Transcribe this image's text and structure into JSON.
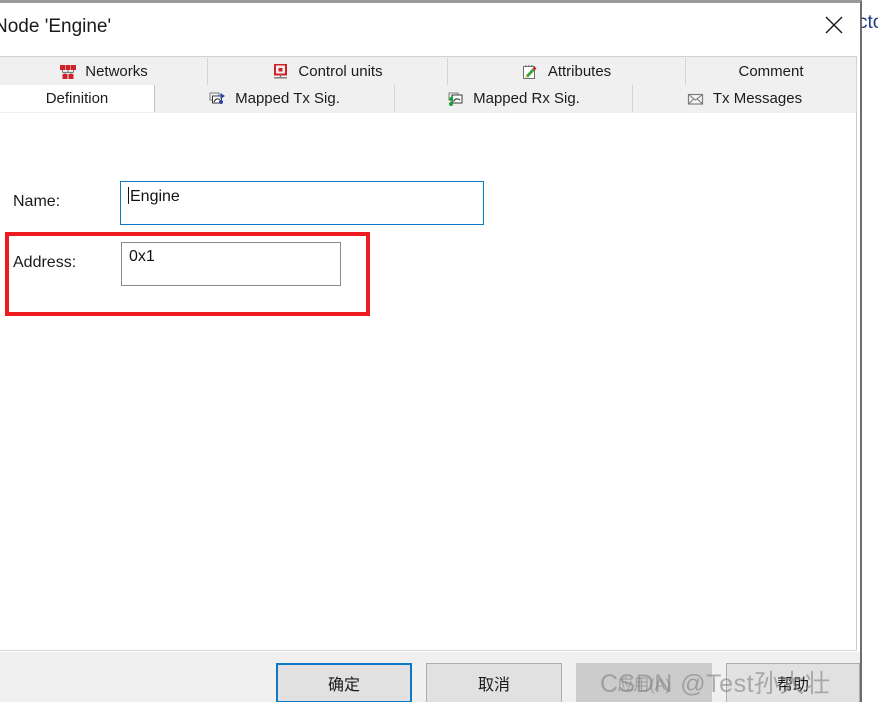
{
  "window": {
    "title": "Node 'Engine'",
    "close_label": "×",
    "background_window_text": "cto"
  },
  "tabs": {
    "row1": [
      {
        "label": "Networks",
        "icon": "network-icon",
        "active": false
      },
      {
        "label": "Control units",
        "icon": "control-unit-icon",
        "active": false
      },
      {
        "label": "Attributes",
        "icon": "attributes-icon",
        "active": false
      },
      {
        "label": "Comment",
        "icon": "",
        "active": false
      }
    ],
    "row2": [
      {
        "label": "Definition",
        "icon": "",
        "active": true
      },
      {
        "label": "Mapped Tx Sig.",
        "icon": "mapped-tx-icon",
        "active": false
      },
      {
        "label": "Mapped Rx Sig.",
        "icon": "mapped-rx-icon",
        "active": false
      },
      {
        "label": "Tx Messages",
        "icon": "envelope-icon",
        "active": false
      }
    ]
  },
  "form": {
    "name": {
      "label": "Name:",
      "value": "Engine",
      "placeholder": "",
      "focused": true
    },
    "address": {
      "label": "Address:",
      "value": "0x1",
      "placeholder": "",
      "focused": false
    }
  },
  "annotation": {
    "color": "#ee1b21",
    "target": "address-field-group"
  },
  "buttons": {
    "ok": "确定",
    "cancel": "取消",
    "apply": "应用(A)",
    "help": "帮助"
  },
  "watermark": {
    "text": "CSDN @Test孙大壮"
  },
  "colors": {
    "accent": "#0a7ac6",
    "annotation": "#ee1b21",
    "tabstrip_bg": "#f0f0f0",
    "buttonbar_bg": "#f0f0f0",
    "content_bg": "#ffffff"
  }
}
